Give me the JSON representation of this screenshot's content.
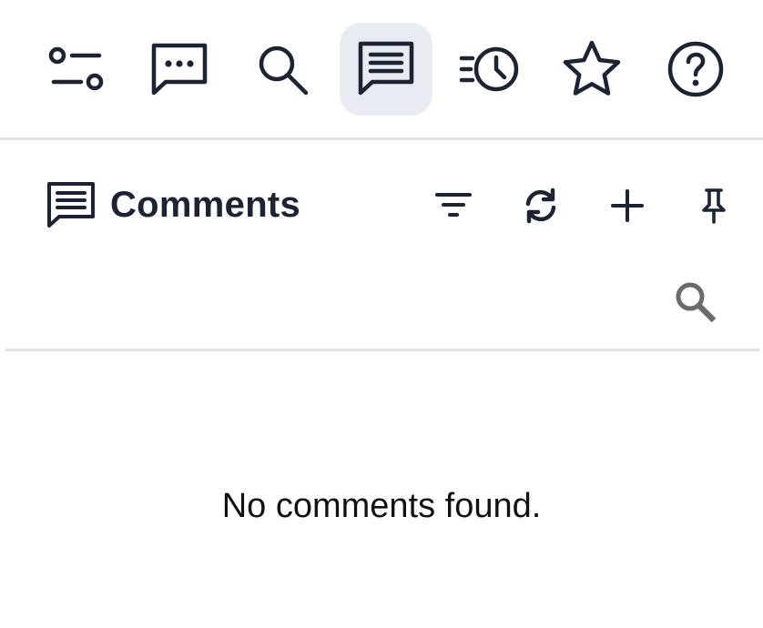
{
  "toolbar": {
    "buttons": [
      {
        "icon": "sliders-icon",
        "active": false
      },
      {
        "icon": "chat-bubble-dots-icon",
        "active": false
      },
      {
        "icon": "search-icon",
        "active": false
      },
      {
        "icon": "comments-icon",
        "active": true
      },
      {
        "icon": "history-list-icon",
        "active": false
      },
      {
        "icon": "star-icon",
        "active": false
      },
      {
        "icon": "help-circle-icon",
        "active": false
      }
    ],
    "active_bg": "#e8ebf2"
  },
  "panel": {
    "title": "Comments",
    "title_icon": "comments-icon",
    "actions": [
      {
        "icon": "filter-icon"
      },
      {
        "icon": "refresh-icon"
      },
      {
        "icon": "plus-icon"
      },
      {
        "icon": "pin-icon"
      }
    ],
    "search_icon": "search-icon"
  },
  "empty_state": {
    "message": "No comments found."
  },
  "colors": {
    "icon": "#1c2333",
    "search_icon": "#6b6b6b",
    "divider": "#dfe1e5"
  }
}
